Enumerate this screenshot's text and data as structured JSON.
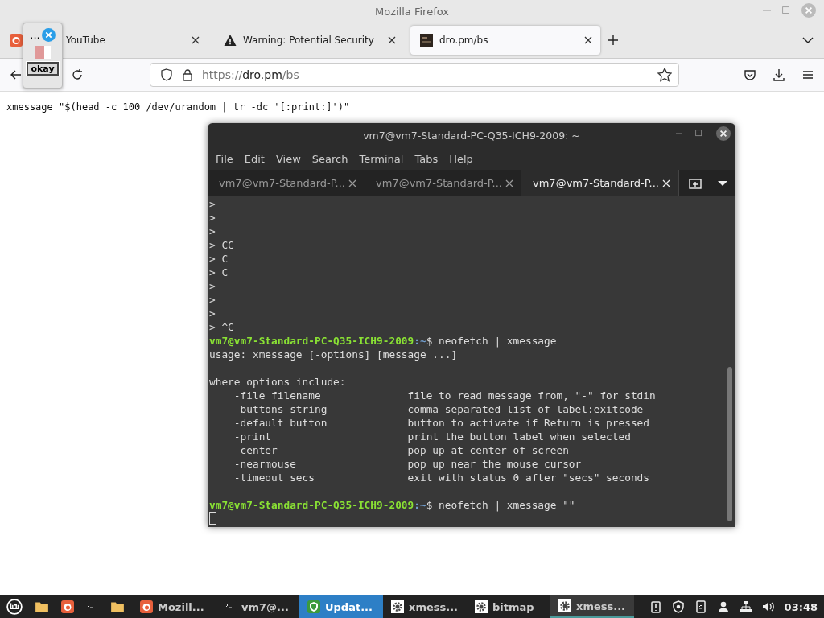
{
  "window": {
    "title": "Mozilla Firefox"
  },
  "tabs": [
    {
      "label": "YouTube",
      "kind": "plain",
      "selected": false
    },
    {
      "label": "Warning: Potential Security",
      "kind": "warning",
      "selected": false
    },
    {
      "label": "dro.pm/bs",
      "kind": "site",
      "selected": true
    }
  ],
  "address_bar": {
    "scheme": "https://",
    "host": "dro.pm",
    "path": "/bs"
  },
  "page": {
    "text": "xmessage \"$(head -c 100 /dev/urandom | tr -dc '[:print:]')\""
  },
  "xmessage_popup": {
    "title": "...",
    "button": "okay"
  },
  "terminal": {
    "title": "vm7@vm7-Standard-PC-Q35-ICH9-2009: ~",
    "menu": [
      "File",
      "Edit",
      "View",
      "Search",
      "Terminal",
      "Tabs",
      "Help"
    ],
    "tabs": [
      {
        "label": "vm7@vm7-Standard-P...",
        "selected": false
      },
      {
        "label": "vm7@vm7-Standard-P...",
        "selected": false
      },
      {
        "label": "vm7@vm7-Standard-P...",
        "selected": true
      }
    ],
    "lines": [
      {
        "kind": "plain",
        "text": ">"
      },
      {
        "kind": "plain",
        "text": ">"
      },
      {
        "kind": "plain",
        "text": ">"
      },
      {
        "kind": "plain",
        "text": "> CC"
      },
      {
        "kind": "plain",
        "text": "> C"
      },
      {
        "kind": "plain",
        "text": "> C"
      },
      {
        "kind": "plain",
        "text": ">"
      },
      {
        "kind": "plain",
        "text": ">"
      },
      {
        "kind": "plain",
        "text": ">"
      },
      {
        "kind": "plain",
        "text": "> ^C"
      },
      {
        "kind": "prompt",
        "user_host": "vm7@vm7-Standard-PC-Q35-ICH9-2009",
        "path": ":~",
        "command": "$ neofetch | xmessage"
      },
      {
        "kind": "plain",
        "text": "usage: xmessage [-options] [message ...]"
      },
      {
        "kind": "blank"
      },
      {
        "kind": "plain",
        "text": "where options include:"
      },
      {
        "kind": "plain",
        "text": "    -file filename              file to read message from, \"-\" for stdin"
      },
      {
        "kind": "plain",
        "text": "    -buttons string             comma-separated list of label:exitcode"
      },
      {
        "kind": "plain",
        "text": "    -default button             button to activate if Return is pressed"
      },
      {
        "kind": "plain",
        "text": "    -print                      print the button label when selected"
      },
      {
        "kind": "plain",
        "text": "    -center                     pop up at center of screen"
      },
      {
        "kind": "plain",
        "text": "    -nearmouse                  pop up near the mouse cursor"
      },
      {
        "kind": "plain",
        "text": "    -timeout secs               exit with status 0 after \"secs\" seconds"
      },
      {
        "kind": "blank"
      },
      {
        "kind": "prompt",
        "user_host": "vm7@vm7-Standard-PC-Q35-ICH9-2009",
        "path": ":~",
        "command": "$ neofetch | xmessage \"\""
      },
      {
        "kind": "cursor"
      }
    ]
  },
  "taskbar": {
    "launchers": [
      {
        "kind": "menu"
      },
      {
        "kind": "folder"
      },
      {
        "kind": "firefox"
      },
      {
        "kind": "terminal"
      },
      {
        "kind": "folder"
      }
    ],
    "windows": [
      {
        "kind": "firefox",
        "label": "Mozill...",
        "selected": false,
        "urgent": false
      },
      {
        "kind": "terminal",
        "label": "vm7@...",
        "selected": false,
        "urgent": false
      },
      {
        "kind": "shield",
        "label": "Updat...",
        "selected": false,
        "urgent": true
      },
      {
        "kind": "gear",
        "label": "xmess...",
        "selected": false,
        "urgent": false
      },
      {
        "kind": "gear",
        "label": "bitmap",
        "selected": false,
        "urgent": false
      },
      {
        "kind": "gear",
        "label": "xmess...",
        "selected": true,
        "urgent": false
      }
    ],
    "tray": [
      {
        "kind": "clipboard"
      },
      {
        "kind": "shield"
      },
      {
        "kind": "document"
      },
      {
        "kind": "person"
      },
      {
        "kind": "network"
      },
      {
        "kind": "speaker"
      }
    ],
    "clock": "03:48"
  }
}
